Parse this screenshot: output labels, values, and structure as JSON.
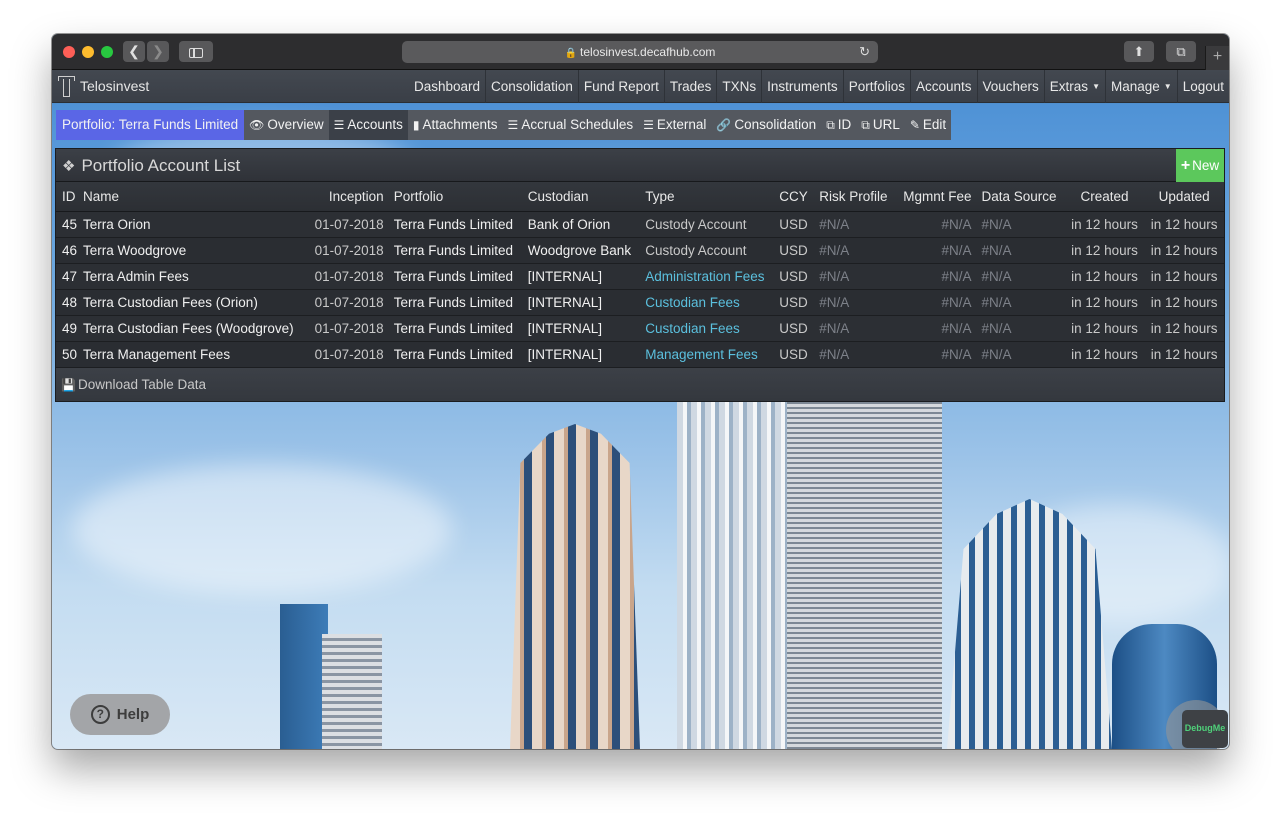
{
  "browser": {
    "url": "telosinvest.decafhub.com",
    "back_icon": "chevron-left",
    "forward_icon": "chevron-right",
    "reload_icon": "reload",
    "share_icon": "share",
    "tabs_icon": "tabs",
    "new_tab": "+"
  },
  "navbar": {
    "brand": "Telosinvest",
    "items": [
      {
        "label": "Dashboard"
      },
      {
        "label": "Consolidation"
      },
      {
        "label": "Fund Report"
      },
      {
        "label": "Trades"
      },
      {
        "label": "TXNs"
      },
      {
        "label": "Instruments"
      },
      {
        "label": "Portfolios"
      },
      {
        "label": "Accounts"
      },
      {
        "label": "Vouchers"
      },
      {
        "label": "Extras",
        "dropdown": true
      },
      {
        "label": "Manage",
        "dropdown": true
      },
      {
        "label": "Logout"
      }
    ]
  },
  "subnav": {
    "title": "Portfolio: Terra Funds Limited",
    "items": [
      {
        "label": "Overview",
        "icon": "👁",
        "active": false
      },
      {
        "label": "Accounts",
        "icon": "☰",
        "active": true
      },
      {
        "label": "Attachments",
        "icon": "▙",
        "active": false
      },
      {
        "label": "Accrual Schedules",
        "icon": "☰",
        "active": false
      },
      {
        "label": "External",
        "icon": "☰",
        "active": false
      },
      {
        "label": "Consolidation",
        "icon": "%",
        "active": false
      },
      {
        "label": "ID",
        "icon": "⧉",
        "active": false
      },
      {
        "label": "URL",
        "icon": "⧉",
        "active": false
      },
      {
        "label": "Edit",
        "icon": "✎",
        "active": false
      }
    ]
  },
  "panel": {
    "title": "Portfolio Account List",
    "new_button": "New",
    "columns": [
      "ID",
      "Name",
      "Inception",
      "Portfolio",
      "Custodian",
      "Type",
      "CCY",
      "Risk Profile",
      "Mgmnt Fee",
      "Data Source",
      "Created",
      "Updated"
    ],
    "rows": [
      {
        "id": "45",
        "name": "Terra Orion",
        "inception": "01-07-2018",
        "portfolio": "Terra Funds Limited",
        "custodian": "Bank of Orion",
        "type": "Custody Account",
        "type_link": false,
        "ccy": "USD",
        "risk": "#N/A",
        "fee": "#N/A",
        "source": "#N/A",
        "created": "in 12 hours",
        "updated": "in 12 hours"
      },
      {
        "id": "46",
        "name": "Terra Woodgrove",
        "inception": "01-07-2018",
        "portfolio": "Terra Funds Limited",
        "custodian": "Woodgrove Bank",
        "type": "Custody Account",
        "type_link": false,
        "ccy": "USD",
        "risk": "#N/A",
        "fee": "#N/A",
        "source": "#N/A",
        "created": "in 12 hours",
        "updated": "in 12 hours"
      },
      {
        "id": "47",
        "name": "Terra Admin Fees",
        "inception": "01-07-2018",
        "portfolio": "Terra Funds Limited",
        "custodian": "[INTERNAL]",
        "type": "Administration Fees",
        "type_link": true,
        "ccy": "USD",
        "risk": "#N/A",
        "fee": "#N/A",
        "source": "#N/A",
        "created": "in 12 hours",
        "updated": "in 12 hours"
      },
      {
        "id": "48",
        "name": "Terra Custodian Fees (Orion)",
        "inception": "01-07-2018",
        "portfolio": "Terra Funds Limited",
        "custodian": "[INTERNAL]",
        "type": "Custodian Fees",
        "type_link": true,
        "ccy": "USD",
        "risk": "#N/A",
        "fee": "#N/A",
        "source": "#N/A",
        "created": "in 12 hours",
        "updated": "in 12 hours"
      },
      {
        "id": "49",
        "name": "Terra Custodian Fees (Woodgrove)",
        "inception": "01-07-2018",
        "portfolio": "Terra Funds Limited",
        "custodian": "[INTERNAL]",
        "type": "Custodian Fees",
        "type_link": true,
        "ccy": "USD",
        "risk": "#N/A",
        "fee": "#N/A",
        "source": "#N/A",
        "created": "in 12 hours",
        "updated": "in 12 hours"
      },
      {
        "id": "50",
        "name": "Terra Management Fees",
        "inception": "01-07-2018",
        "portfolio": "Terra Funds Limited",
        "custodian": "[INTERNAL]",
        "type": "Management Fees",
        "type_link": true,
        "ccy": "USD",
        "risk": "#N/A",
        "fee": "#N/A",
        "source": "#N/A",
        "created": "in 12 hours",
        "updated": "in 12 hours"
      }
    ],
    "footer": "Download Table Data"
  },
  "widgets": {
    "help": "Help",
    "debug": "DebugMe"
  },
  "colors": {
    "subnav_title_bg": "#5a66e6",
    "new_button_bg": "#5cc85c",
    "link": "#5bc0de"
  }
}
